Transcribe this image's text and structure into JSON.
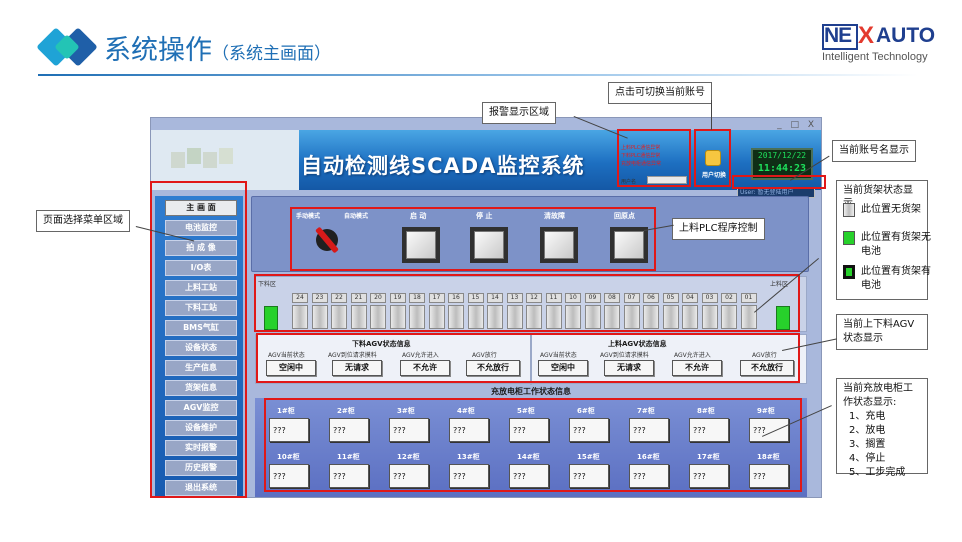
{
  "slide": {
    "title": "系统操作",
    "subtitle": "（系统主画面）",
    "logo_ne": "NE",
    "logo_x": "X",
    "logo_auto": "AUTO",
    "logo_tagline": "Intelligent Technology"
  },
  "scada": {
    "window_controls": "_ □ X",
    "title": "自动检测线SCADA监控系统",
    "alarm_lines": [
      "上料PLC通信异常",
      "下料PLC通信异常",
      "充放电柜通信异常"
    ],
    "alarm_name_label": "用户名",
    "user_switch_label": "用户切换",
    "clock_date": "2017/12/22",
    "clock_time": "11:44:23",
    "account_display": "User: 暂无登陆用户",
    "menu": [
      {
        "label": "主 画 面",
        "active": true
      },
      {
        "label": "电池监控",
        "active": false
      },
      {
        "label": "拍 成 像",
        "active": false
      },
      {
        "label": "I/O表",
        "active": false
      },
      {
        "label": "上料工站",
        "active": false
      },
      {
        "label": "下料工站",
        "active": false
      },
      {
        "label": "BMS气缸",
        "active": false
      },
      {
        "label": "设备状态",
        "active": false
      },
      {
        "label": "生产信息",
        "active": false
      },
      {
        "label": "货架信息",
        "active": false
      },
      {
        "label": "AGV监控",
        "active": false
      },
      {
        "label": "设备维护",
        "active": false
      },
      {
        "label": "实时报警",
        "active": false
      },
      {
        "label": "历史报警",
        "active": false
      },
      {
        "label": "退出系统",
        "active": false
      }
    ],
    "plc": {
      "manual_mode": "手动模式",
      "auto_mode": "自动模式",
      "buttons": [
        "启 动",
        "停 止",
        "清故障",
        "回原点"
      ]
    },
    "rack": {
      "unload_zone": "下料区",
      "load_zone": "上料区",
      "slots": [
        "24",
        "23",
        "22",
        "21",
        "20",
        "19",
        "18",
        "17",
        "16",
        "15",
        "14",
        "13",
        "12",
        "11",
        "10",
        "09",
        "08",
        "07",
        "06",
        "05",
        "04",
        "03",
        "02",
        "01"
      ]
    },
    "agv_unload": {
      "header": "下料AGV状态信息",
      "sublabels": [
        "AGV当前状态",
        "AGV到位请求摸料",
        "AGV允许进入",
        "AGV放行"
      ],
      "values": [
        "空闲中",
        "无请求",
        "不允许",
        "不允放行"
      ]
    },
    "agv_load": {
      "header": "上料AGV状态信息",
      "sublabels": [
        "AGV当前状态",
        "AGV到位请求摸料",
        "AGV允许进入",
        "AGV放行"
      ],
      "values": [
        "空闲中",
        "无请求",
        "不允许",
        "不允放行"
      ]
    },
    "cabinet": {
      "title": "充放电柜工作状态信息",
      "row1": [
        "1#柜",
        "2#柜",
        "3#柜",
        "4#柜",
        "5#柜",
        "6#柜",
        "7#柜",
        "8#柜",
        "9#柜"
      ],
      "row2": [
        "10#柜",
        "11#柜",
        "12#柜",
        "13#柜",
        "14#柜",
        "15#柜",
        "16#柜",
        "17#柜",
        "18#柜"
      ],
      "value": "???"
    }
  },
  "callouts": {
    "alarm_area": "报警显示区域",
    "switch_account": "点击可切换当前账号",
    "account_name": "当前账号名显示",
    "menu_area": "页面选择菜单区域",
    "plc_control": "上料PLC程序控制",
    "rack_title": "当前货架状态显示",
    "rack_states": [
      "此位置无货架",
      "此位置有货架无电池",
      "此位置有货架有电池"
    ],
    "rack_state_colors": [
      "#cfcfcf",
      "#27d12b",
      "#111111"
    ],
    "agv_status": "当前上下料AGV状态显示",
    "cab_status_title": "当前充放电柜工作状态显示:",
    "cab_status_items": [
      "1、充电",
      "2、放电",
      "3、搁置",
      "4、停止",
      "5、工步完成"
    ]
  }
}
